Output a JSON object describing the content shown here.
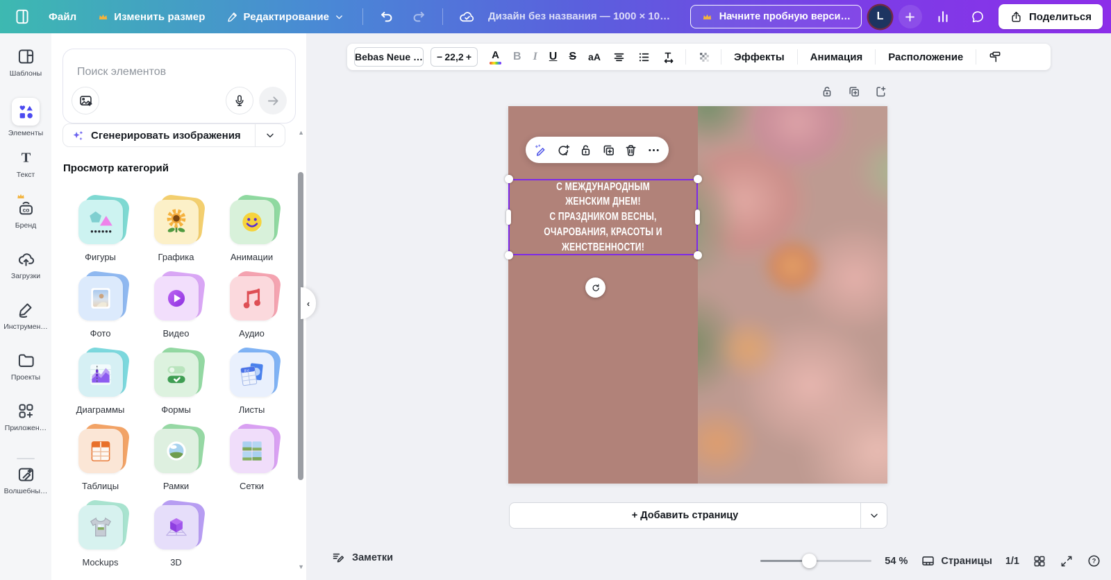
{
  "topbar": {
    "file": "Файл",
    "resize": "Изменить размер",
    "editing": "Редактирование",
    "title": "Дизайн без названия — 1000 × 10…",
    "trial": "Начните пробную верси…",
    "avatar_initial": "L",
    "share": "Поделиться"
  },
  "sidebar": {
    "items": [
      {
        "label": "Шаблоны"
      },
      {
        "label": "Элементы"
      },
      {
        "label": "Текст"
      },
      {
        "label": "Бренд"
      },
      {
        "label": "Загрузки"
      },
      {
        "label": "Инструмен…"
      },
      {
        "label": "Проекты"
      },
      {
        "label": "Приложен…"
      },
      {
        "label": "Волшебны…"
      }
    ],
    "selected": "Элементы"
  },
  "panel": {
    "search_placeholder": "Поиск элементов",
    "generate": "Сгенерировать изображения",
    "categories_heading": "Просмотр категорий",
    "categories": [
      "Фигуры",
      "Графика",
      "Анимации",
      "Фото",
      "Видео",
      "Аудио",
      "Диаграммы",
      "Формы",
      "Листы",
      "Таблицы",
      "Рамки",
      "Сетки",
      "Mockups",
      "3D"
    ]
  },
  "toolbar": {
    "font": "Bebas Neue …",
    "size": "22,2",
    "minus": "−",
    "plus": "+",
    "color_letter": "A",
    "bold": "B",
    "italic": "I",
    "underline": "U",
    "strikethrough": "S",
    "case": "aA",
    "effects": "Эффекты",
    "animation": "Анимация",
    "position": "Расположение"
  },
  "canvas": {
    "text_lines": [
      "С МЕЖДУНАРОДНЫМ",
      "ЖЕНСКИМ ДНЕМ!",
      "С ПРАЗДНИКОМ ВЕСНЫ,",
      "ОЧАРОВАНИЯ, КРАСОТЫ И",
      "ЖЕНСТВЕННОСТИ!"
    ],
    "add_page": "+ Добавить страницу"
  },
  "statusbar": {
    "notes": "Заметки",
    "zoom": "54 %",
    "pages_label": "Страницы",
    "page_indicator": "1/1",
    "help": "?"
  },
  "colors": {
    "accent_purple": "#7d2ae8",
    "selection_purple": "#7d2ae8",
    "page_mauve": "#b18279",
    "topbar_gradient_start": "#3db9b1",
    "topbar_gradient_end": "#8c2ee9",
    "crown_gold": "#f2b33d"
  },
  "icons": [
    "design-grid-icon",
    "crown-icon",
    "pencil-icon",
    "chevron-down-icon",
    "undo-icon",
    "redo-icon",
    "cloud-check-icon",
    "bar-chart-icon",
    "comment-bubble-icon",
    "share-upload-icon",
    "plus-icon",
    "templates-icon",
    "elements-icon",
    "text-icon",
    "brand-icon",
    "uploads-icon",
    "tools-icon",
    "projects-icon",
    "apps-icon",
    "magic-icon",
    "image-add-icon",
    "mic-icon",
    "arrow-right-icon",
    "sparkles-icon",
    "text-color-icon",
    "align-icon",
    "list-icon",
    "spacing-icon",
    "transparency-icon",
    "paint-roller-icon",
    "unlock-icon",
    "duplicate-icon",
    "import-page-icon",
    "magic-pen-icon",
    "comment-add-icon",
    "lock-icon",
    "trash-icon",
    "more-dots-icon",
    "rotate-icon",
    "notes-icon",
    "pages-icon",
    "grid-view-icon",
    "expand-icon",
    "help-icon"
  ]
}
